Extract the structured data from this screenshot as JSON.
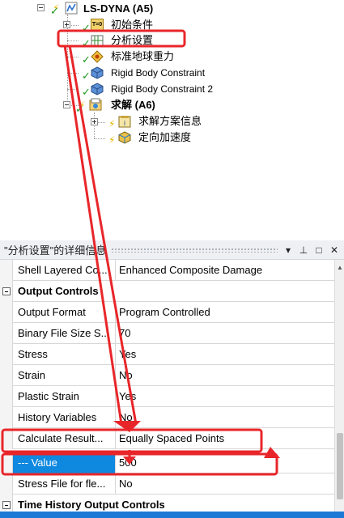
{
  "tree": {
    "root": {
      "label": "LS-DYNA (A5)",
      "icon": "ls-dyna-system-icon"
    },
    "items": [
      {
        "label": "初始条件",
        "icon": "initial-conditions-icon"
      },
      {
        "label": "分析设置",
        "icon": "analysis-settings-icon"
      },
      {
        "label": "标准地球重力",
        "icon": "gravity-icon"
      },
      {
        "label": "Rigid Body Constraint",
        "icon": "rigid-body-constraint-icon"
      },
      {
        "label": "Rigid Body Constraint 2",
        "icon": "rigid-body-constraint-icon"
      },
      {
        "label": "求解 (A6)",
        "icon": "solution-icon"
      },
      {
        "label": "求解方案信息",
        "icon": "solution-information-icon"
      },
      {
        "label": "定向加速度",
        "icon": "directional-acceleration-icon"
      }
    ],
    "initial_conditions_badge": "T=0"
  },
  "details": {
    "title": "\"分析设置\"的详细信息",
    "pin_glyph": "▾",
    "pushpin_glyph": "⊥",
    "maximize_glyph": "□",
    "close_glyph": "✕",
    "rows": [
      {
        "name": "Shell Layered Co...",
        "value": "Enhanced Composite Damage"
      },
      {
        "name": "Output Controls",
        "value": ""
      },
      {
        "name": "Output Format",
        "value": "Program Controlled"
      },
      {
        "name": "Binary File Size S...",
        "value": "70"
      },
      {
        "name": "Stress",
        "value": "Yes"
      },
      {
        "name": "Strain",
        "value": "No"
      },
      {
        "name": "Plastic Strain",
        "value": "Yes"
      },
      {
        "name": "History Variables",
        "value": "No"
      },
      {
        "name": "Calculate Result...",
        "value": "Equally Spaced Points"
      },
      {
        "name": "--- Value",
        "value": "500"
      },
      {
        "name": "Stress File for fle...",
        "value": "No"
      },
      {
        "name": "Time History Output Controls",
        "value": ""
      }
    ]
  },
  "colors": {
    "selection": "#0f88e0",
    "annotation_red": "#e8262a",
    "check_green": "#1e9a1e",
    "taskbar": "#1c79d6"
  }
}
